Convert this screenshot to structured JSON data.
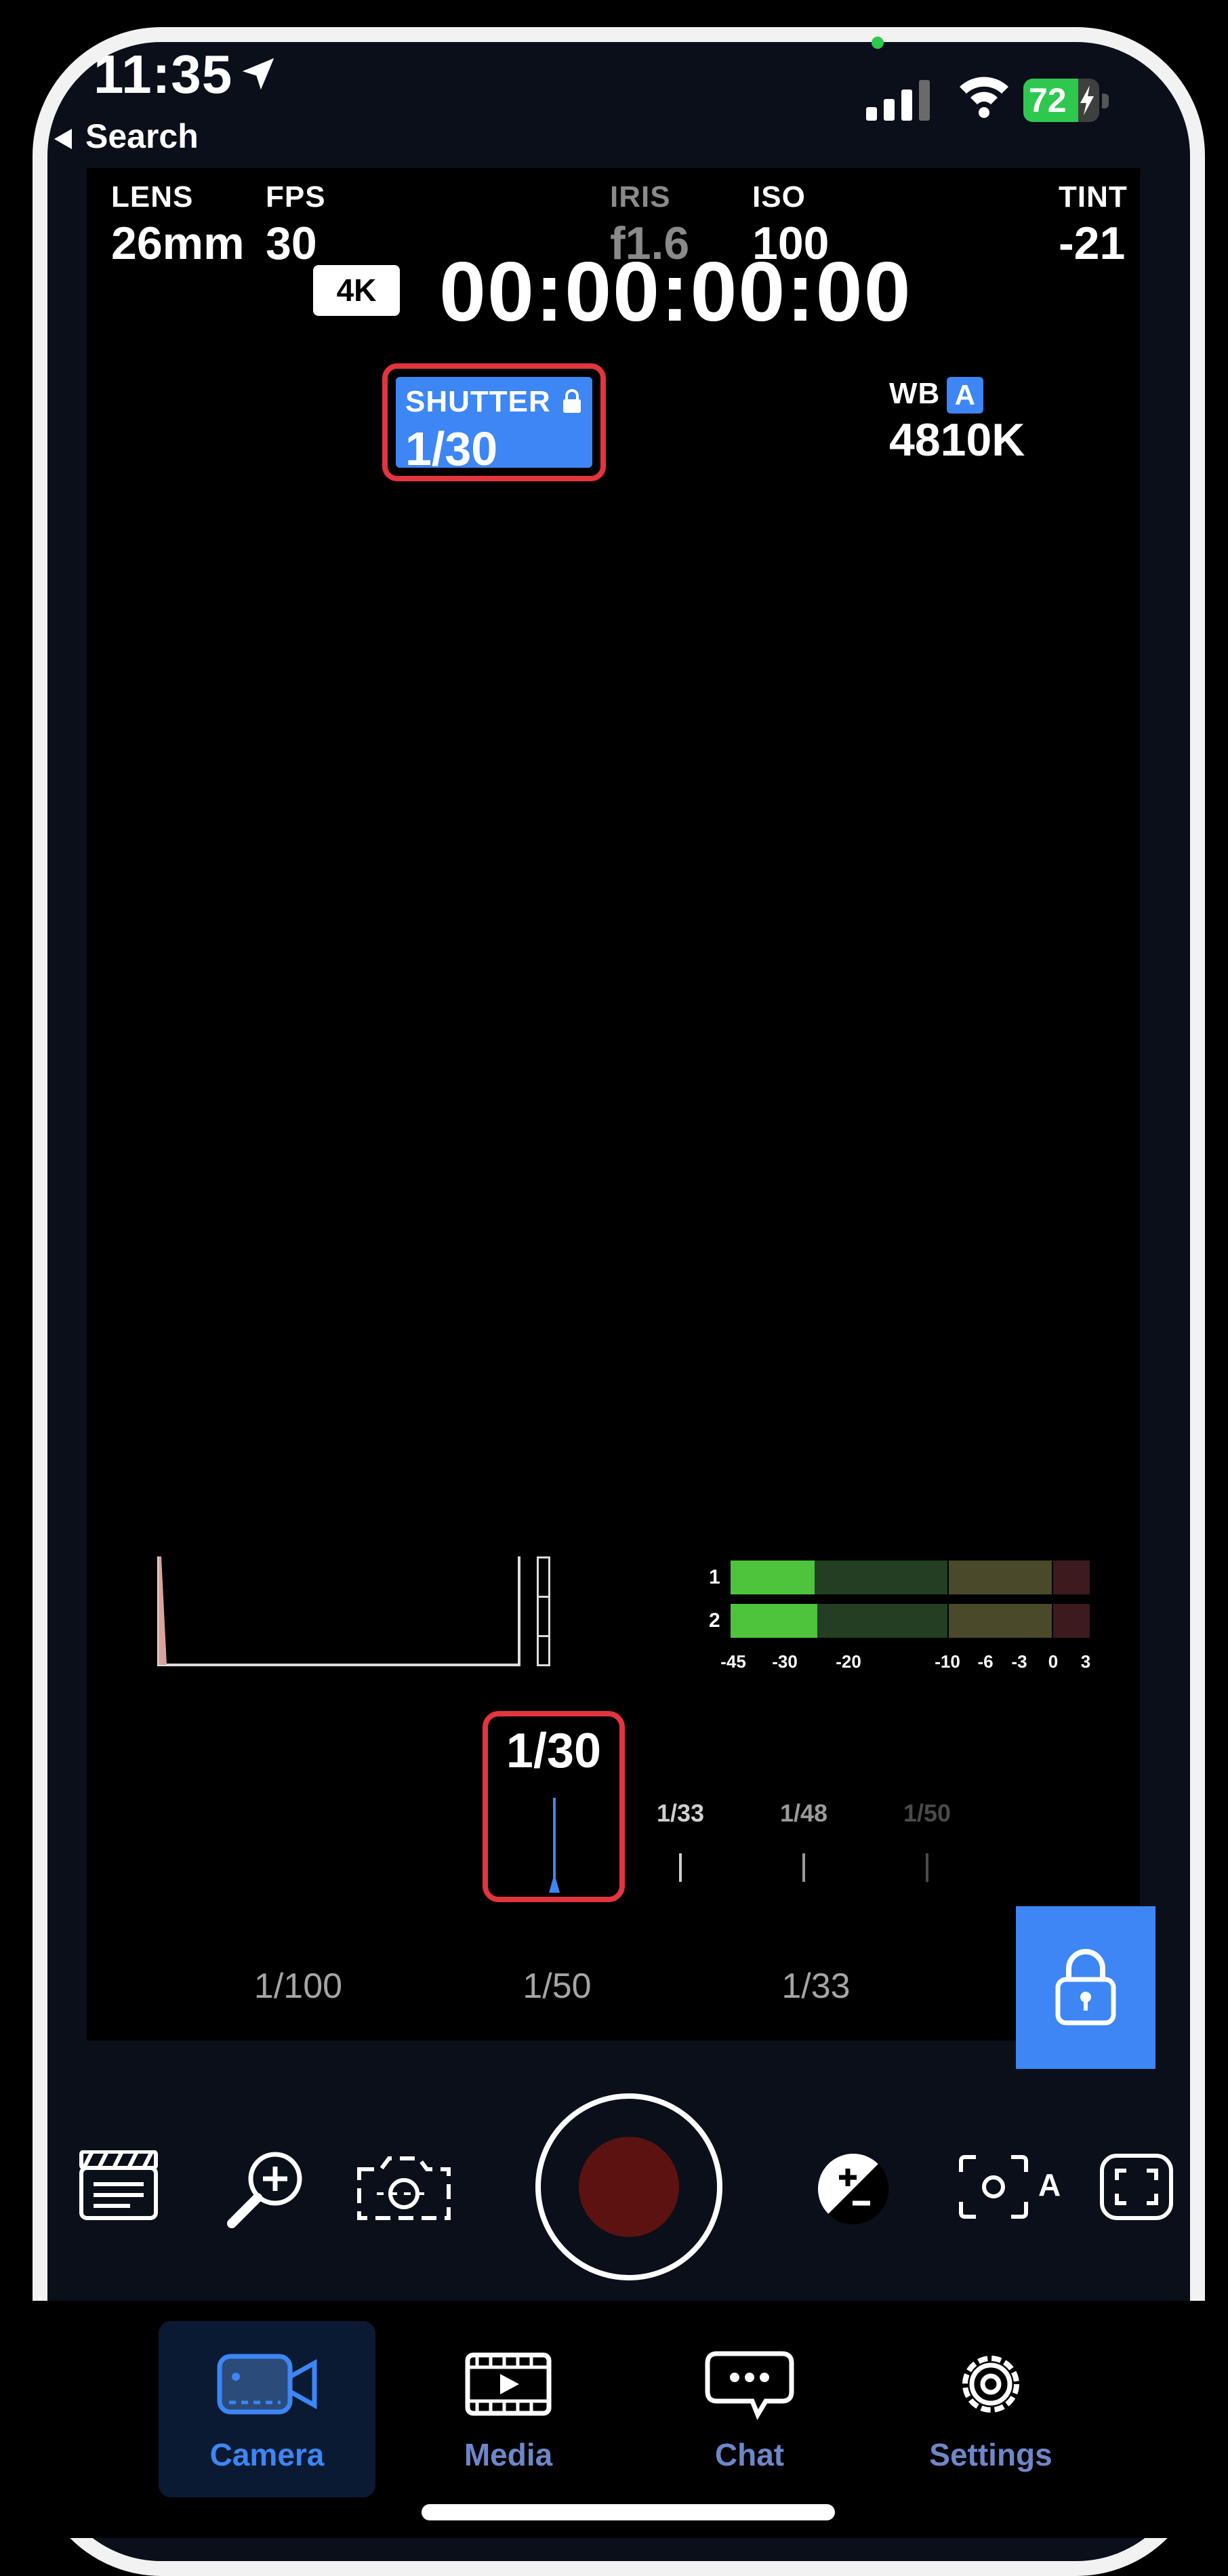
{
  "status_bar": {
    "time": "11:35",
    "back_label": "Search",
    "battery_percent": "72",
    "battery_level": 0.72
  },
  "viewfinder": {
    "resolution": "4K",
    "timecode": "00:00:00:00",
    "params": {
      "lens": {
        "label": "LENS",
        "value": "26mm"
      },
      "fps": {
        "label": "FPS",
        "value": "30"
      },
      "shutter": {
        "label": "SHUTTER",
        "value": "1/30"
      },
      "iris": {
        "label": "IRIS",
        "value": "f1.6"
      },
      "iso": {
        "label": "ISO",
        "value": "100"
      },
      "wb": {
        "label": "WB",
        "badge": "A",
        "value": "4810K"
      },
      "tint": {
        "label": "TINT",
        "value": "-21"
      }
    },
    "audio": {
      "channels": [
        "1",
        "2"
      ],
      "scale": [
        "-45",
        "-30",
        "-20",
        "-10",
        "-6",
        "-3",
        "0",
        "3"
      ]
    },
    "shutter_dial": {
      "current": "1/30",
      "ticks": [
        "1/33",
        "1/48",
        "1/50"
      ]
    },
    "presets": [
      "1/100",
      "1/50",
      "1/33"
    ]
  },
  "toolbar": {
    "icons": [
      "clapper-icon",
      "zoom-in-icon",
      "flip-camera-icon",
      "record-button",
      "exposure-icon",
      "focus-auto-icon",
      "fullscreen-icon"
    ],
    "focus_mode": "A"
  },
  "tabs": [
    {
      "label": "Camera",
      "icon": "video-camera-icon",
      "active": true
    },
    {
      "label": "Media",
      "icon": "film-play-icon",
      "active": false
    },
    {
      "label": "Chat",
      "icon": "chat-bubble-icon",
      "active": false
    },
    {
      "label": "Settings",
      "icon": "gear-icon",
      "active": false
    }
  ],
  "colors": {
    "accent": "#3d86f4",
    "highlight_border": "#e2353d",
    "record": "#5c1211",
    "meter_green": "#4ec43c"
  }
}
